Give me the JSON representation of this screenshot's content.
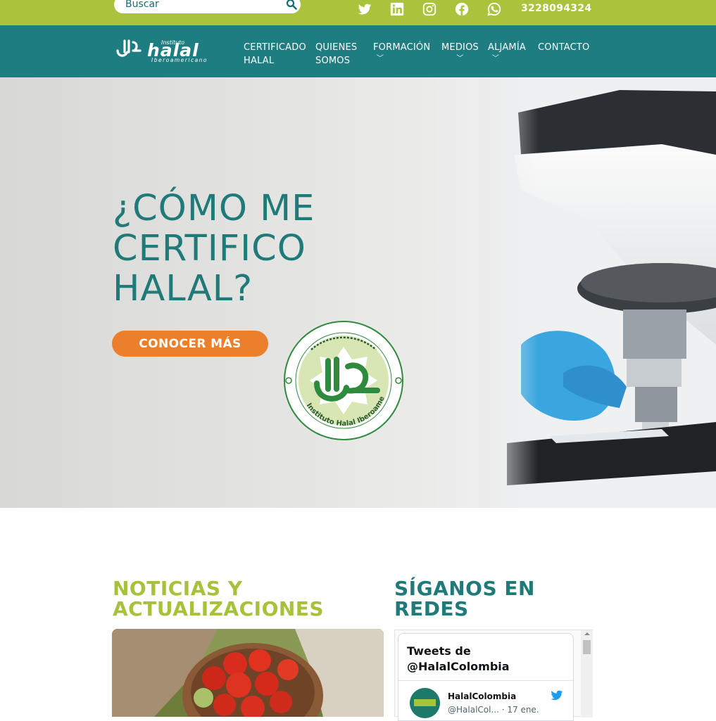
{
  "topbar": {
    "search_placeholder": "Buscar",
    "social_icons": [
      "twitter-icon",
      "linkedin-icon",
      "instagram-icon",
      "facebook-icon",
      "whatsapp-icon"
    ],
    "phone": "3228094324"
  },
  "nav": {
    "logo_alt": "Instituto halal Iberoamericano",
    "items": [
      {
        "line1": "CERTIFICADO",
        "line2": "HALAL",
        "dropdown": false
      },
      {
        "line1": "QUIENES",
        "line2": "SOMOS",
        "dropdown": false
      },
      {
        "line1": "FORMACIÓN",
        "line2": "",
        "dropdown": true
      },
      {
        "line1": "MEDIOS",
        "line2": "",
        "dropdown": true
      },
      {
        "line1": "ALJAMÍA",
        "line2": "",
        "dropdown": true
      },
      {
        "line1": "CONTACTO",
        "line2": "",
        "dropdown": false
      }
    ]
  },
  "hero": {
    "title_line1": "¿CÓMO ME",
    "title_line2": "CERTIFICO",
    "title_line3": "HALAL?",
    "cta_label": "CONOCER MÁS",
    "seal_text": "Instituto Halal Iberoamericano"
  },
  "news": {
    "title_line1": "NOTICIAS Y",
    "title_line2": "ACTUALIZACIONES"
  },
  "social_section": {
    "title_line1": "SÍGANOS EN",
    "title_line2": "REDES"
  },
  "twitter": {
    "header_line1": "Tweets de",
    "header_line2": "@HalalColombia",
    "tweet_name": "HalalColombia",
    "tweet_handle": "@HalalCol...",
    "tweet_date": "· 17 ene."
  },
  "colors": {
    "topbar": "#a9c43c",
    "navbar": "#1e7d80",
    "accent_orange": "#ec7f2c",
    "title_teal": "#1f7a79",
    "title_green": "#a6c23a"
  }
}
